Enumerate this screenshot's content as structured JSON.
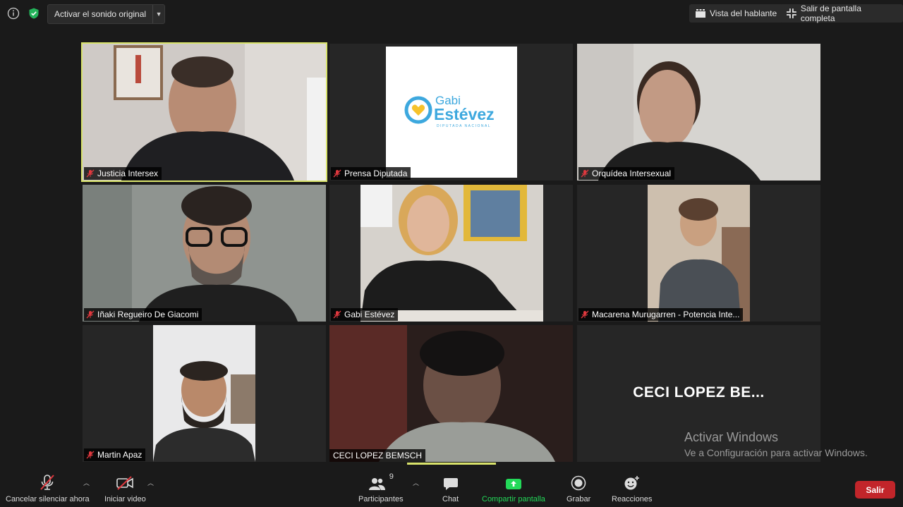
{
  "topbar": {
    "audio_label": "Activar el sonido original",
    "speaker_view_label": "Vista del hablante",
    "exit_fullscreen_label": "Salir de pantalla completa"
  },
  "tiles": [
    {
      "name": "Justicia Intersex"
    },
    {
      "name": "Prensa Diputada",
      "logo_line1": "Gabi",
      "logo_line2": "Estévez",
      "logo_line3": "DIPUTADA NACIONAL"
    },
    {
      "name": "Orquídea Intersexual"
    },
    {
      "name": "Iñaki Regueiro De Giacomi"
    },
    {
      "name": "Gabi Estévez"
    },
    {
      "name": "Macarena Murugarren - Potencia Inte..."
    },
    {
      "name": "Martin Apaz"
    },
    {
      "name": "CECI LOPEZ BEMSCH"
    },
    {
      "display_name": "CECI LOPEZ BE..."
    }
  ],
  "watermark": {
    "line1": "Activar Windows",
    "line2": "Ve a Configuración para activar Windows."
  },
  "toolbar": {
    "unmute_label": "Cancelar silenciar ahora",
    "video_label": "Iniciar video",
    "participants_label": "Participantes",
    "participants_count": "9",
    "chat_label": "Chat",
    "share_label": "Compartir pantalla",
    "record_label": "Grabar",
    "reactions_label": "Reacciones",
    "leave_label": "Salir"
  },
  "colors": {
    "active_speaker": "#d9e36b",
    "share_green": "#23d959",
    "leave_red": "#c2252a",
    "muted_red": "#e0383e",
    "logo_blue": "#3da8de"
  }
}
